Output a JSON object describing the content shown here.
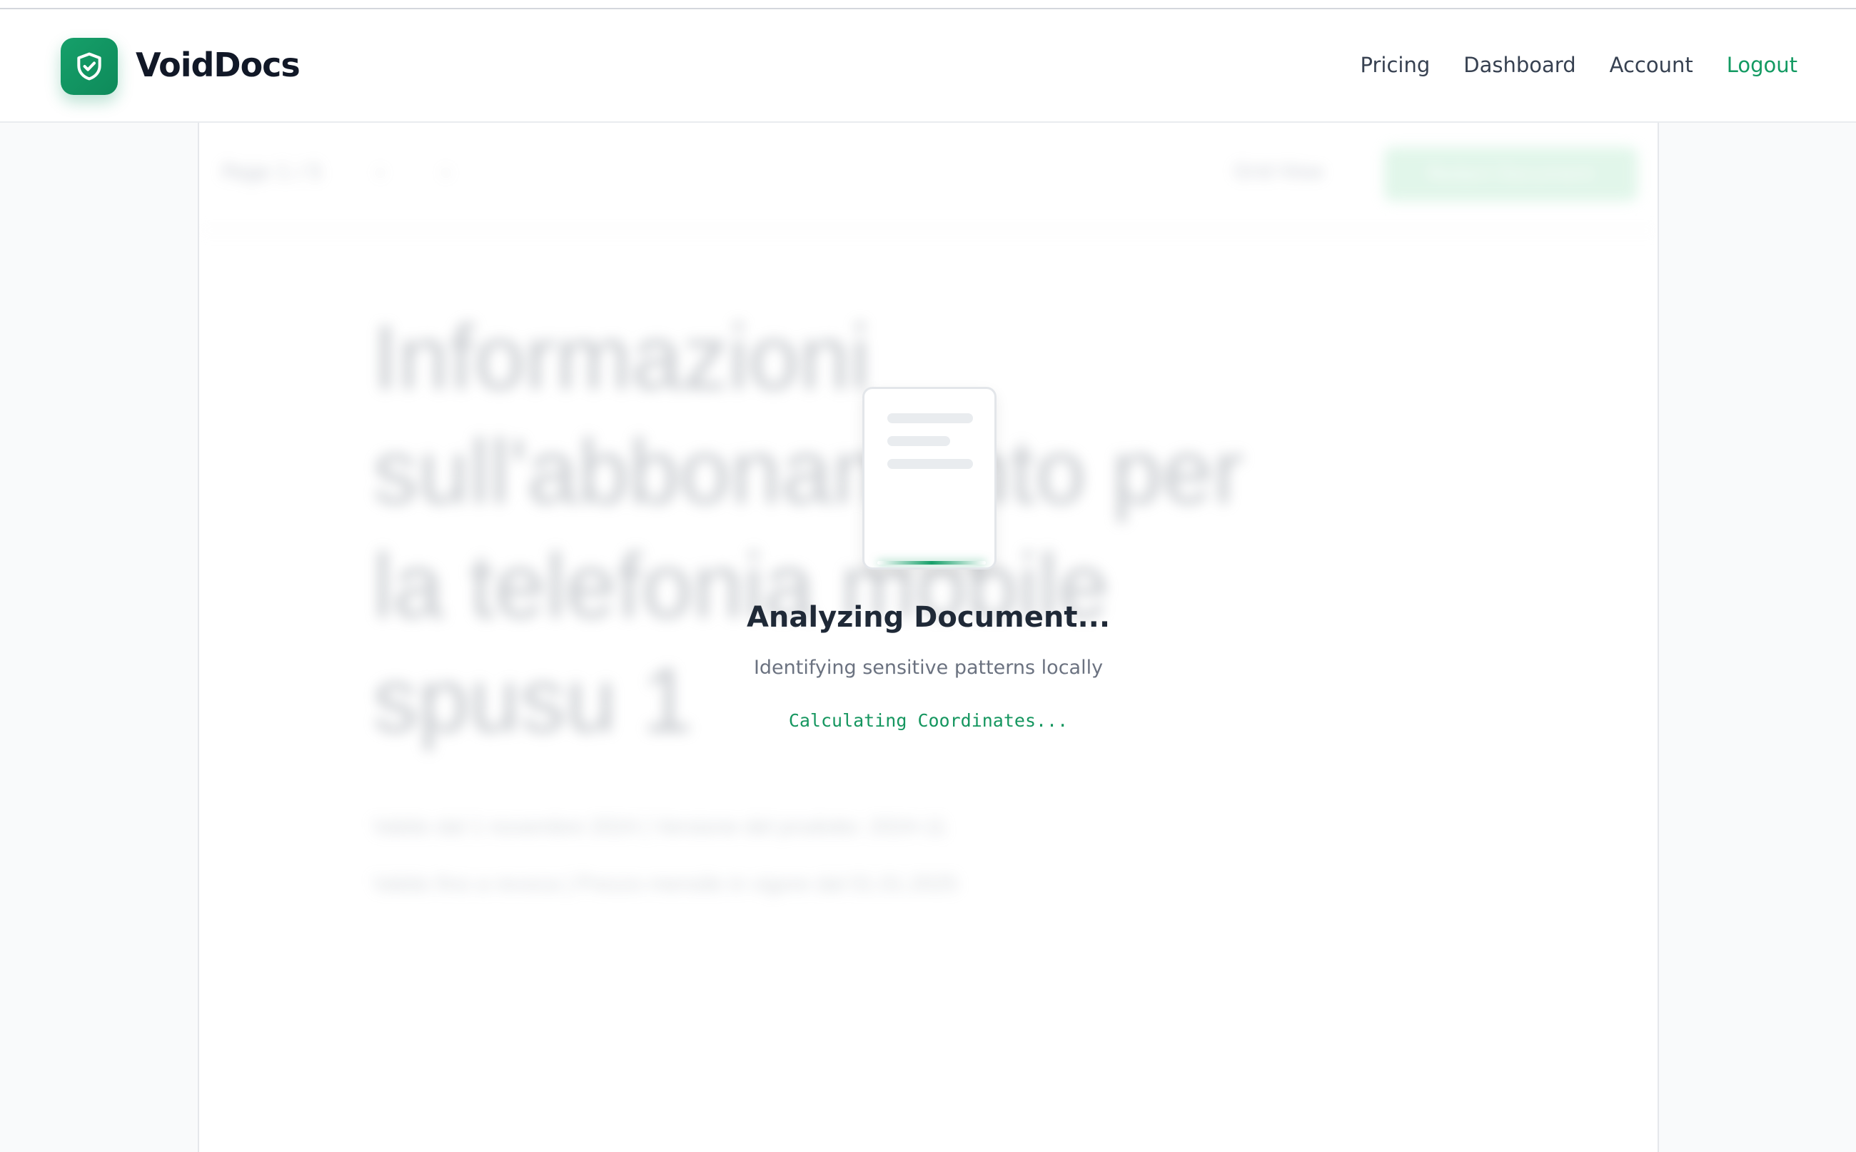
{
  "app": {
    "brand": "VoidDocs",
    "logo_icon": "shield-check-icon",
    "accent_color": "#139a62"
  },
  "nav": {
    "items": [
      {
        "label": "Pricing"
      },
      {
        "label": "Dashboard"
      },
      {
        "label": "Account"
      }
    ],
    "logout_label": "Logout"
  },
  "document": {
    "toolbar": {
      "page_label": "Page 1 / 5",
      "prev_label": "‹",
      "next_label": "›",
      "view_toggle_label": "Grid View",
      "action_label": "Redact Document"
    },
    "title": "Informazioni sull'abbonamento per la telefonia mobile spusu 1",
    "lines": [
      "Valido dal 1 novembre 2024 | Versione del prodotto: 2024-11",
      "Valido fino a revoca | Prezzo mensile in vigore dal 01.01.2025"
    ]
  },
  "status": {
    "icon": "document-scan-icon",
    "title": "Analyzing Document...",
    "subtitle": "Identifying sensitive patterns locally",
    "step": "Calculating Coordinates..."
  }
}
